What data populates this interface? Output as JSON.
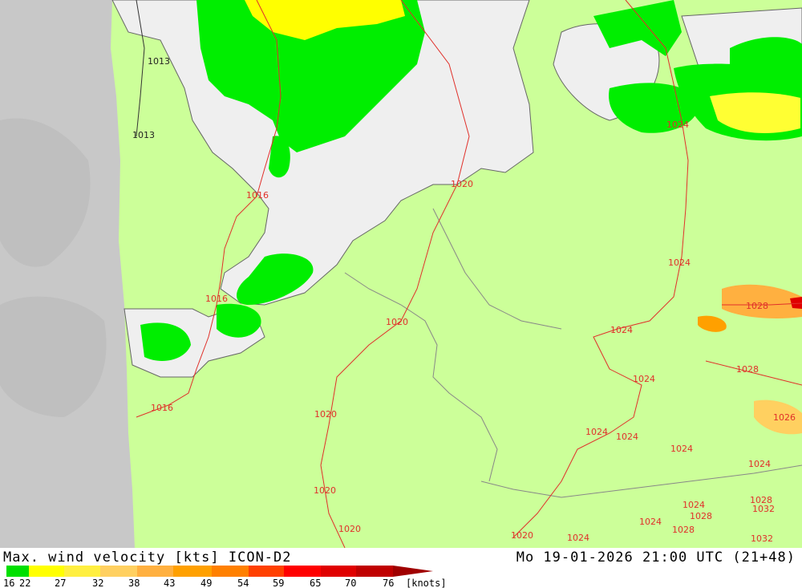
{
  "title_left": "Max. wind velocity [kts] ICON-D2",
  "title_right": "Mo 19-01-2026 21:00 UTC (21+48)",
  "legend": {
    "ticks": [
      "16",
      "22",
      "27",
      "32",
      "38",
      "43",
      "49",
      "54",
      "59",
      "65",
      "70",
      "76"
    ],
    "unit": "[knots]",
    "colors": [
      "#00e000",
      "#ffff00",
      "#ffef40",
      "#ffd060",
      "#ffb040",
      "#ffa000",
      "#ff8000",
      "#ff4000",
      "#ff0000",
      "#e00000",
      "#c00000",
      "#a00000"
    ]
  },
  "isobars": [
    {
      "label": "1013",
      "color": "black"
    },
    {
      "label": "1013",
      "color": "black"
    },
    {
      "label": "1016",
      "color": "red"
    },
    {
      "label": "1016",
      "color": "red"
    },
    {
      "label": "1016",
      "color": "red"
    },
    {
      "label": "1020",
      "color": "red"
    },
    {
      "label": "1020",
      "color": "red"
    },
    {
      "label": "1020",
      "color": "red"
    },
    {
      "label": "1020",
      "color": "red"
    },
    {
      "label": "1020",
      "color": "red"
    },
    {
      "label": "1020",
      "color": "red"
    },
    {
      "label": "1024",
      "color": "red"
    },
    {
      "label": "1024",
      "color": "red"
    },
    {
      "label": "1024",
      "color": "red"
    },
    {
      "label": "1024",
      "color": "red"
    },
    {
      "label": "1024",
      "color": "red"
    },
    {
      "label": "1024",
      "color": "red"
    },
    {
      "label": "1024",
      "color": "red"
    },
    {
      "label": "1024",
      "color": "red"
    },
    {
      "label": "1024",
      "color": "red"
    },
    {
      "label": "1024",
      "color": "red"
    },
    {
      "label": "1024",
      "color": "red"
    },
    {
      "label": "1028",
      "color": "red"
    },
    {
      "label": "1028",
      "color": "red"
    },
    {
      "label": "1026",
      "color": "red"
    },
    {
      "label": "1028",
      "color": "red"
    },
    {
      "label": "1032",
      "color": "red"
    },
    {
      "label": "1028",
      "color": "red"
    },
    {
      "label": "1028",
      "color": "red"
    },
    {
      "label": "1032",
      "color": "red"
    }
  ]
}
